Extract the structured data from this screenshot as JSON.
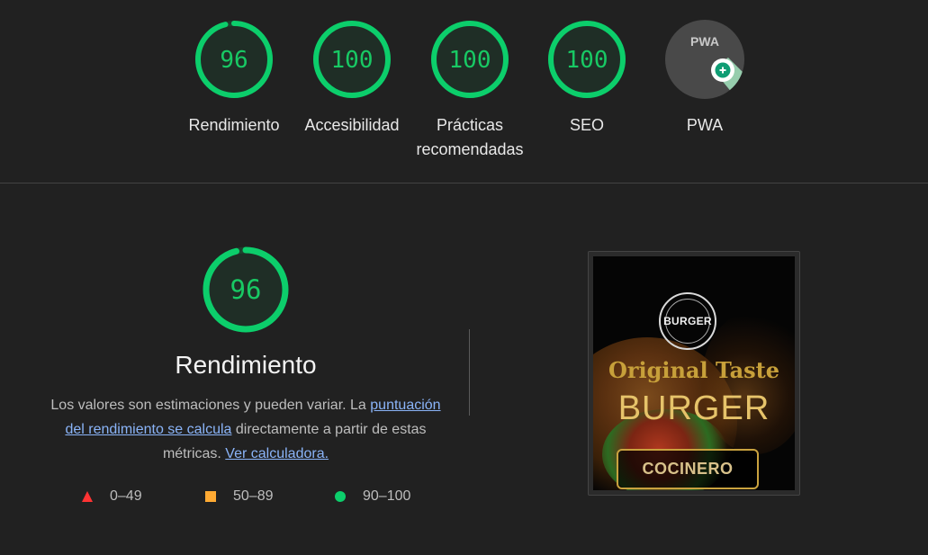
{
  "top_gauges": [
    {
      "id": "performance",
      "score": "96",
      "score_value": 96,
      "label": "Rendimiento"
    },
    {
      "id": "accessibility",
      "score": "100",
      "score_value": 100,
      "label": "Accesibilidad"
    },
    {
      "id": "best-practices",
      "score": "100",
      "score_value": 100,
      "label_line1": "Prácticas",
      "label_line2": "recomendadas"
    },
    {
      "id": "seo",
      "score": "100",
      "score_value": 100,
      "label": "SEO"
    },
    {
      "id": "pwa",
      "badge_text": "PWA",
      "label": "PWA"
    }
  ],
  "performance_detail": {
    "score": "96",
    "score_value": 96,
    "title": "Rendimiento",
    "desc_part1": "Los valores son estimaciones y pueden variar. La ",
    "desc_link1": "puntuación del rendimiento se calcula",
    "desc_part2": " directamente a partir de estas métricas. ",
    "desc_link2": "Ver calculadora."
  },
  "legend": [
    {
      "range": "0–49",
      "shape": "triangle",
      "color": "#ff3333"
    },
    {
      "range": "50–89",
      "shape": "square",
      "color": "#ffaa33"
    },
    {
      "range": "90–100",
      "shape": "circle",
      "color": "#0cce6b"
    }
  ],
  "screenshot": {
    "logo_text": "BURGER",
    "tagline": "Original Taste",
    "headline": "BURGER",
    "button_label": "COCINERO"
  },
  "colors": {
    "pass": "#0cce6b",
    "pass_text": "#18c964",
    "background": "#212121",
    "link": "#8ab4f8"
  }
}
